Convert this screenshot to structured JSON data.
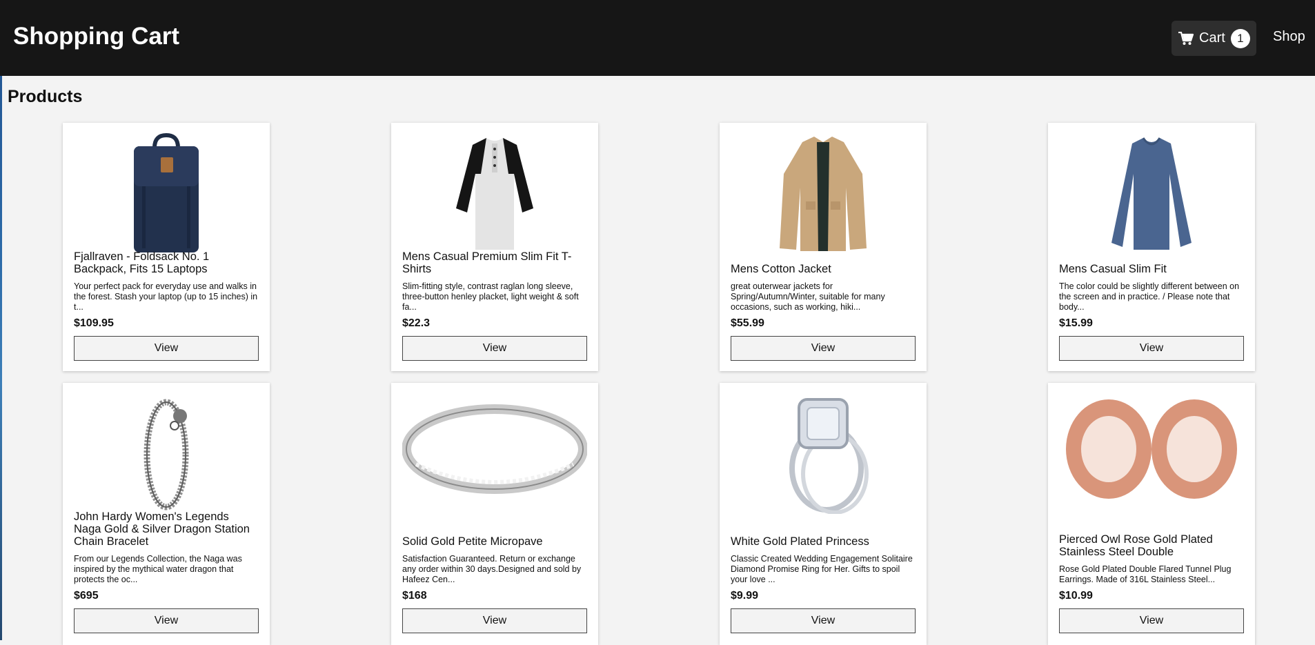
{
  "header": {
    "title": "Shopping Cart",
    "cart_label": "Cart",
    "cart_count": "1",
    "shop_label": "Shop"
  },
  "main": {
    "section_title": "Products",
    "view_label": "View"
  },
  "products": [
    {
      "title": "Fjallraven - Foldsack No. 1 Backpack, Fits 15 Laptops",
      "description": "Your perfect pack for everyday use and walks in the forest. Stash your laptop (up to 15 inches) in t...",
      "price": "$109.95"
    },
    {
      "title": "Mens Casual Premium Slim Fit T-Shirts",
      "description": "Slim-fitting style, contrast raglan long sleeve, three-button henley placket, light weight & soft fa...",
      "price": "$22.3"
    },
    {
      "title": "Mens Cotton Jacket",
      "description": "great outerwear jackets for Spring/Autumn/Winter, suitable for many occasions, such as working, hiki...",
      "price": "$55.99"
    },
    {
      "title": "Mens Casual Slim Fit",
      "description": "The color could be slightly different between on the screen and in practice. / Please note that body...",
      "price": "$15.99"
    },
    {
      "title": "John Hardy Women's Legends Naga Gold & Silver Dragon Station Chain Bracelet",
      "description": "From our Legends Collection, the Naga was inspired by the mythical water dragon that protects the oc...",
      "price": "$695"
    },
    {
      "title": "Solid Gold Petite Micropave",
      "description": "Satisfaction Guaranteed. Return or exchange any order within 30 days.Designed and sold by Hafeez Cen...",
      "price": "$168"
    },
    {
      "title": "White Gold Plated Princess",
      "description": "Classic Created Wedding Engagement Solitaire Diamond Promise Ring for Her. Gifts to spoil your love ...",
      "price": "$9.99"
    },
    {
      "title": "Pierced Owl Rose Gold Plated Stainless Steel Double",
      "description": "Rose Gold Plated Double Flared Tunnel Plug Earrings. Made of 316L Stainless Steel...",
      "price": "$10.99"
    }
  ],
  "colors": {
    "header_bg": "#161616",
    "page_bg": "#f3f3f3",
    "cart_button_bg": "#2e2e2e"
  }
}
